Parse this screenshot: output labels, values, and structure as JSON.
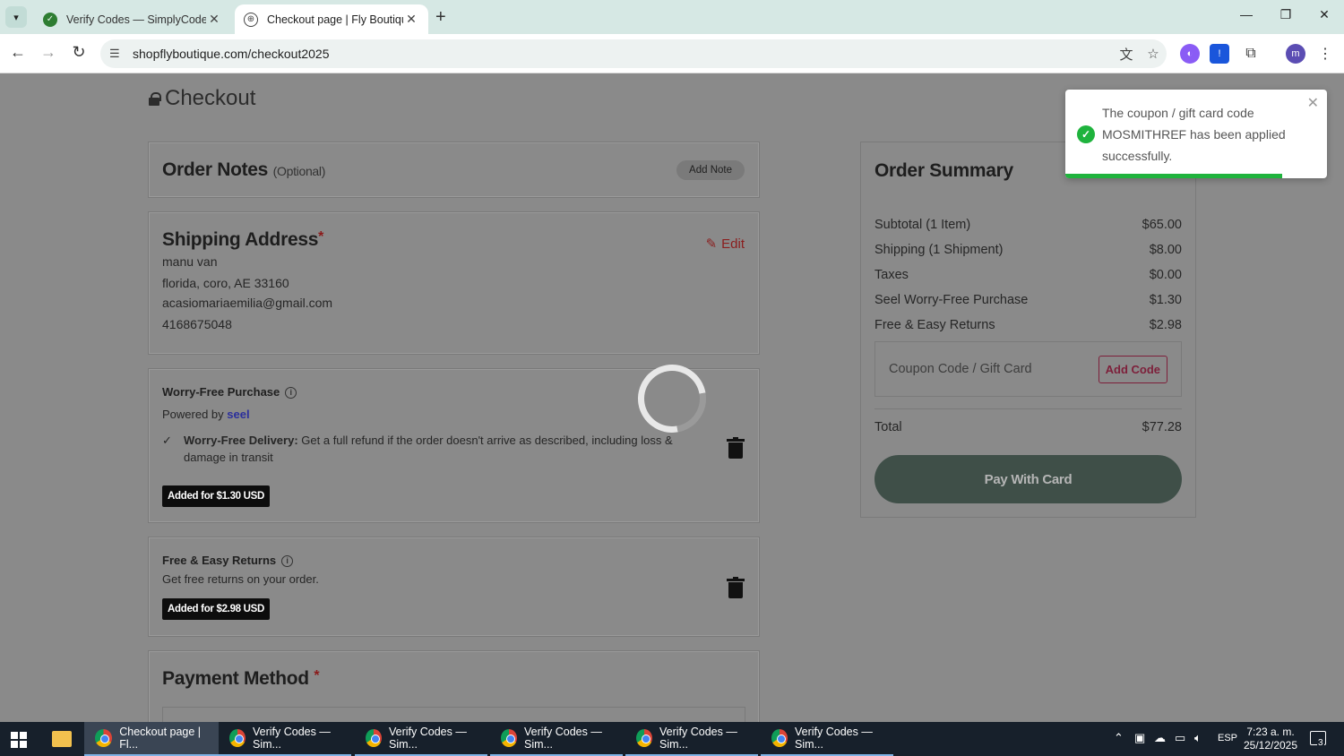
{
  "browser": {
    "tabs": [
      {
        "title": "Verify Codes — SimplyCodes",
        "active": false
      },
      {
        "title": "Checkout page | Fly Boutique",
        "active": true
      }
    ],
    "url": "shopflyboutique.com/checkout2025",
    "profile_initial": "m"
  },
  "page": {
    "title": "Checkout",
    "order_notes": {
      "heading": "Order Notes",
      "optional": "(Optional)",
      "button": "Add Note"
    },
    "shipping": {
      "heading": "Shipping Address",
      "required_mark": "*",
      "edit": "Edit",
      "lines": [
        "manu van",
        "florida, coro, AE 33160",
        "acasiomariaemilia@gmail.com",
        "4168675048"
      ]
    },
    "worry_free": {
      "heading": "Worry-Free Purchase",
      "powered_by": "Powered by",
      "brand": "seel",
      "feature_title": "Worry-Free Delivery:",
      "feature_text": "Get a full refund if the order doesn't arrive as described, including loss & damage in transit",
      "badge": "Added for $1.30 USD"
    },
    "returns": {
      "heading": "Free & Easy Returns",
      "text": "Get free returns on your order.",
      "badge": "Added for $2.98 USD"
    },
    "payment": {
      "heading": "Payment Method",
      "required_mark": "*"
    }
  },
  "summary": {
    "heading": "Order Summary",
    "rows": [
      {
        "label": "Subtotal (1 Item)",
        "value": "$65.00"
      },
      {
        "label": "Shipping (1 Shipment)",
        "value": "$8.00"
      },
      {
        "label": "Taxes",
        "value": "$0.00"
      },
      {
        "label": "Seel Worry-Free Purchase",
        "value": "$1.30"
      },
      {
        "label": "Free & Easy Returns",
        "value": "$2.98"
      }
    ],
    "coupon_placeholder": "Coupon Code / Gift Card",
    "coupon_button": "Add Code",
    "total_label": "Total",
    "total_value": "$77.28",
    "pay_button": "Pay With Card"
  },
  "toast": {
    "message": "The coupon / gift card code MOSMITHREF has been applied successfully.",
    "progress": 0.83,
    "accent": "#1fb33d"
  },
  "taskbar": {
    "tasks": [
      "Checkout page | Fl...",
      "Verify Codes — Sim...",
      "Verify Codes — Sim...",
      "Verify Codes — Sim...",
      "Verify Codes — Sim...",
      "Verify Codes — Sim..."
    ],
    "language": "ESP",
    "time": "7:23 a. m.",
    "date": "25/12/2025",
    "notifications": "3"
  }
}
